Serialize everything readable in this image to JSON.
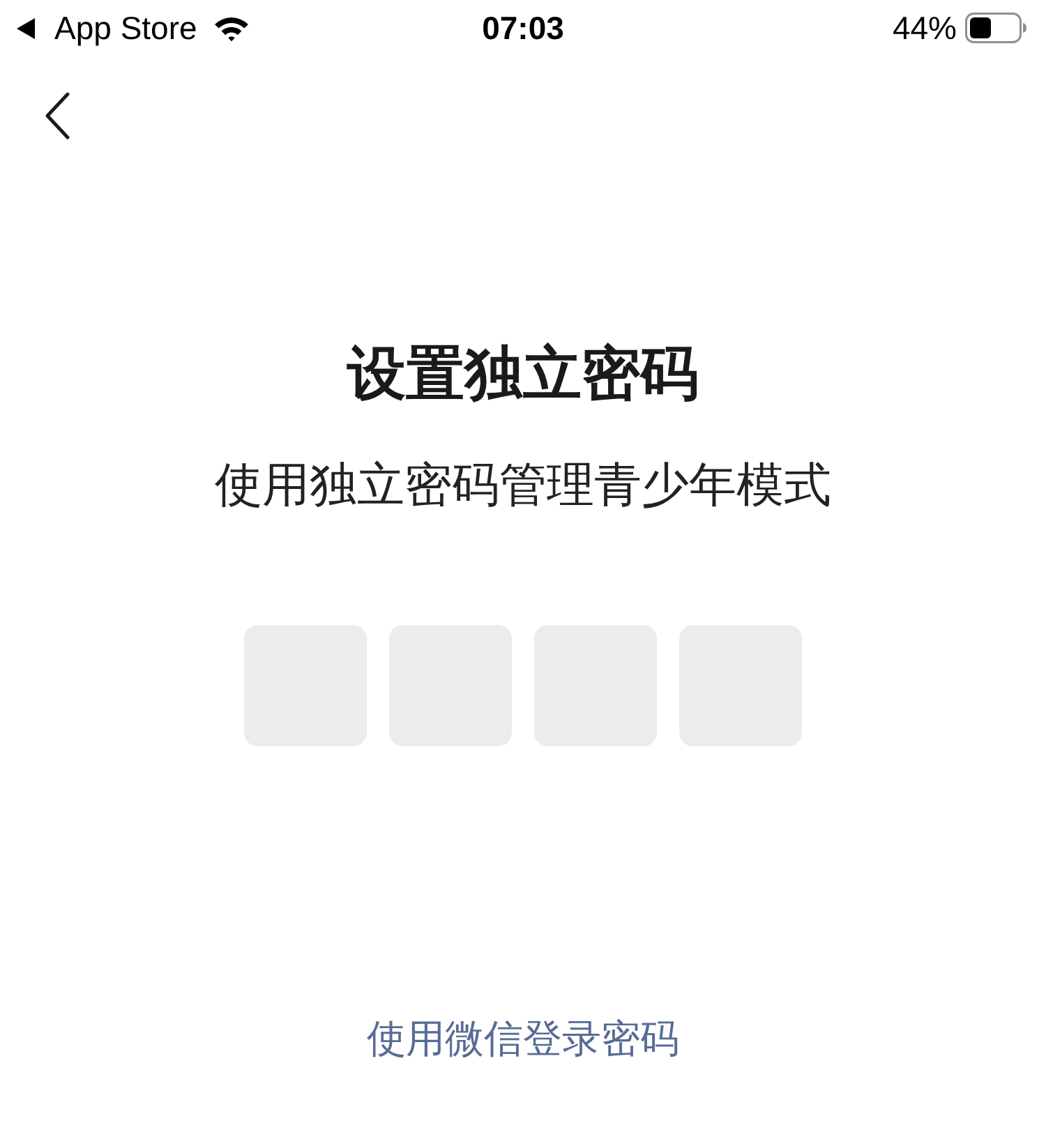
{
  "status_bar": {
    "back_app": "App Store",
    "time": "07:03",
    "battery": "44%"
  },
  "title": "设置独立密码",
  "subtitle": "使用独立密码管理青少年模式",
  "code_fields": [
    {
      "filled": false
    },
    {
      "filled": false
    },
    {
      "filled": false
    },
    {
      "filled": false
    }
  ],
  "wechat_link": "使用微信登录密码"
}
